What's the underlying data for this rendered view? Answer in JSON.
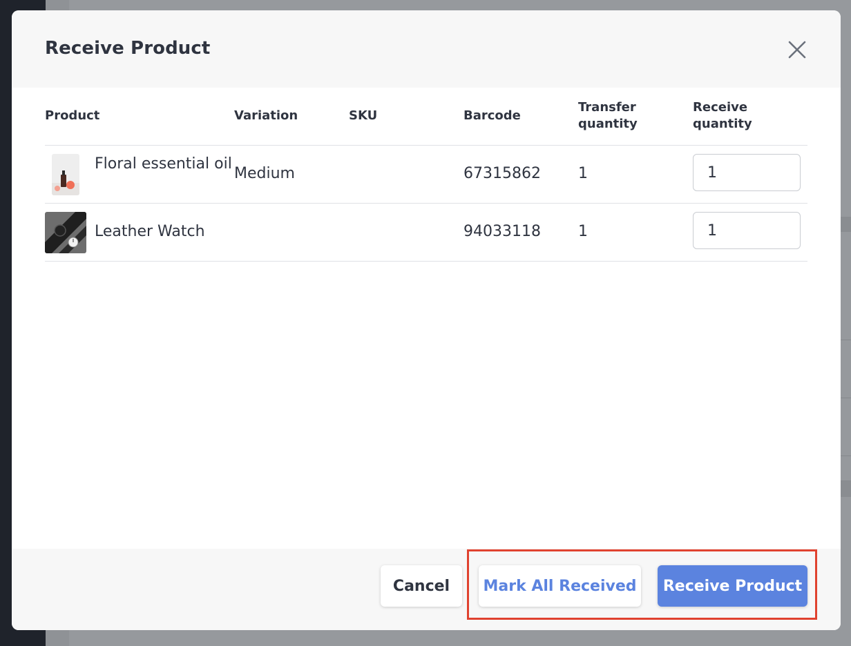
{
  "modal": {
    "title": "Receive Product",
    "close_icon": "close-icon"
  },
  "table": {
    "columns": {
      "product": "Product",
      "variation": "Variation",
      "sku": "SKU",
      "barcode": "Barcode",
      "transfer_qty": "Transfer quantity",
      "receive_qty": "Receive quantity"
    },
    "rows": [
      {
        "product": "Floral essential oil",
        "variation": "Medium",
        "sku": "",
        "barcode": "67315862",
        "transfer_qty": "1",
        "receive_qty": "1"
      },
      {
        "product": "Leather Watch",
        "variation": "",
        "sku": "",
        "barcode": "94033118",
        "transfer_qty": "1",
        "receive_qty": "1"
      }
    ]
  },
  "footer": {
    "cancel_label": "Cancel",
    "mark_all_label": "Mark All Received",
    "receive_label": "Receive Product"
  },
  "colors": {
    "accent": "#5b83df",
    "highlight": "#e0422f",
    "text": "#2f3440"
  }
}
